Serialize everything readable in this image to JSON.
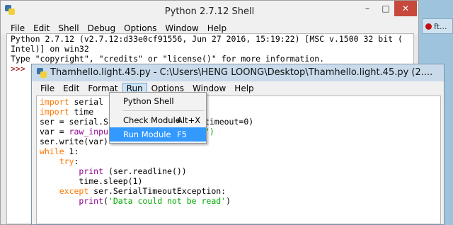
{
  "shell": {
    "title": "Python 2.7.12 Shell",
    "controls": {
      "minimize": "–",
      "maximize": "□",
      "close": "✕"
    },
    "menu": [
      "File",
      "Edit",
      "Shell",
      "Debug",
      "Options",
      "Window",
      "Help"
    ],
    "output": [
      "Python 2.7.12 (v2.7.12:d33e0cf91556, Jun 27 2016, 15:19:22) [MSC v.1500 32 bit (",
      "Intel)] on win32",
      "Type \"copyright\", \"credits\" or \"license()\" for more information.",
      ">>> "
    ]
  },
  "taskbar": {
    "label": "ft..."
  },
  "editor": {
    "title": "Thamhello.light.45.py - C:\\Users\\HENG LOONG\\Desktop\\Thamhello.light.45.py (2....",
    "menu": [
      "File",
      "Edit",
      "Format",
      "Run",
      "Options",
      "Window",
      "Help"
    ],
    "active_menu": "Run",
    "code": {
      "l1_kw": "import",
      "l1_rest": " serial",
      "l2_kw": "import",
      "l2_rest": " time",
      "l3_a": "ser = serial.S",
      "l3_b": "timeout=0)",
      "l4_a": "var = ",
      "l4_bi": "raw_inpu",
      "l4_str": "\")",
      "l5": "ser.write(var)",
      "l6_kw": "while",
      "l6_rest": " 1:",
      "l7_kw": "try",
      "l7_rest": ":",
      "l8_bi": "print",
      "l8_rest": " (ser.readline())",
      "l9": "time.sleep(1)",
      "l10_kw": "except",
      "l10_rest": " ser.SerialTimeoutException:",
      "l11_bi": "print",
      "l11_a": "(",
      "l11_str": "'Data could not be read'",
      "l11_b": ")"
    }
  },
  "run_menu": {
    "items": [
      {
        "label": "Python Shell",
        "shortcut": ""
      },
      {
        "label": "Check Module",
        "shortcut": "Alt+X"
      },
      {
        "label": "Run Module",
        "shortcut": "F5"
      }
    ],
    "highlighted": "Run Module"
  },
  "colors": {
    "keyword": "#ff7700",
    "builtin": "#900090",
    "string": "#00aa00",
    "highlight": "#3399ff"
  }
}
